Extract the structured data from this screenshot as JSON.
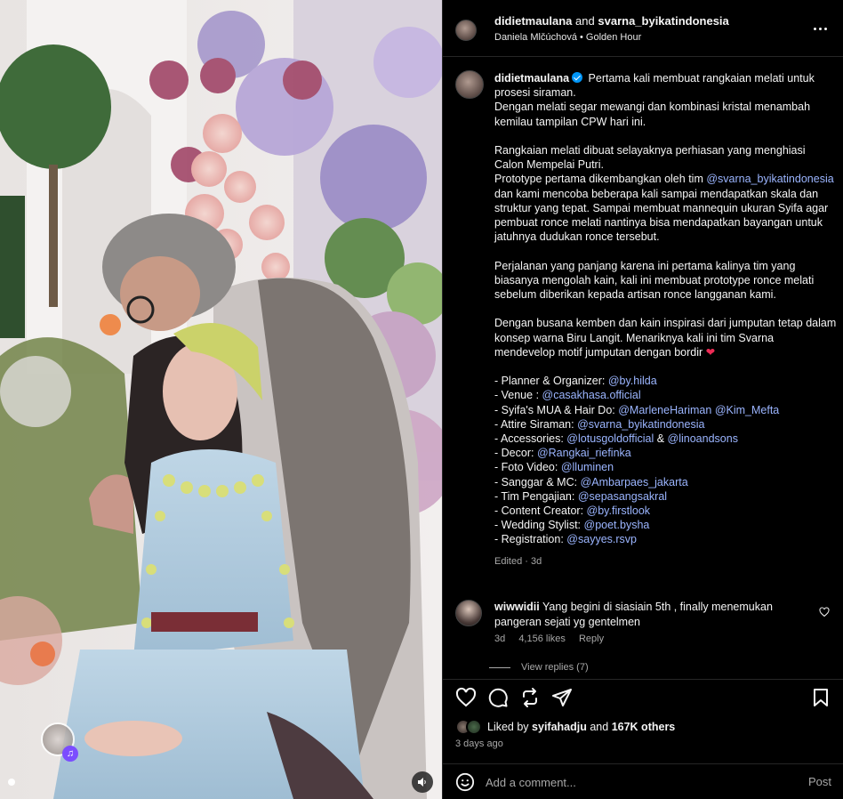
{
  "header": {
    "user1": "didietmaulana",
    "conj": "and",
    "user2": "svarna_byikatindonesia",
    "audio": "Daniela Mlčúchová • Golden Hour"
  },
  "caption": {
    "username": "didietmaulana",
    "intro": "Pertama kali membuat rangkaian melati untuk prosesi siraman.",
    "p1": "Dengan melati segar mewangi dan kombinasi kristal menambah kemilau tampilan CPW hari ini.",
    "p2a": "Rangkaian melati dibuat selayaknya perhiasan yang menghiasi Calon Mempelai Putri.",
    "p2b": "Prototype pertama dikembangkan oleh tim",
    "p2_mention": "@svarna_byikatindonesia",
    "p2c": "dan kami mencoba beberapa kali sampai mendapatkan skala dan struktur yang tepat. Sampai membuat mannequin ukuran Syifa agar pembuat ronce melati nantinya bisa mendapatkan bayangan untuk jatuhnya dudukan ronce tersebut.",
    "p3": "Perjalanan yang panjang karena ini pertama kalinya tim yang biasanya mengolah kain, kali ini membuat prototype ronce melati sebelum diberikan kepada artisan ronce langganan kami.",
    "p4": "Dengan busana kemben dan kain inspirasi dari jumputan tetap dalam konsep warna Biru Langit. Menariknya kali ini tim Svarna mendevelop motif jumputan dengan bordir",
    "heart": "❤",
    "credits": [
      {
        "label": "- Planner & Organizer:",
        "mentions": [
          "@by.hilda"
        ],
        "sep": ""
      },
      {
        "label": "- Venue :",
        "mentions": [
          "@casakhasa.official"
        ],
        "sep": ""
      },
      {
        "label": "- Syifa's MUA & Hair Do:",
        "mentions": [
          "@MarleneHariman",
          "@Kim_Mefta"
        ],
        "sep": " "
      },
      {
        "label": "- Attire Siraman:",
        "mentions": [
          "@svarna_byikatindonesia"
        ],
        "sep": ""
      },
      {
        "label": "- Accessories:",
        "mentions": [
          "@lotusgoldofficial",
          "@linoandsons"
        ],
        "sep": " & "
      },
      {
        "label": "- Decor:",
        "mentions": [
          "@Rangkai_riefinka"
        ],
        "sep": ""
      },
      {
        "label": "- Foto Video:",
        "mentions": [
          "@lluminen"
        ],
        "sep": ""
      },
      {
        "label": "- Sanggar & MC:",
        "mentions": [
          "@Ambarpaes_jakarta"
        ],
        "sep": ""
      },
      {
        "label": "- Tim Pengajian:",
        "mentions": [
          "@sepasangsakral"
        ],
        "sep": ""
      },
      {
        "label": "- Content Creator:",
        "mentions": [
          "@by.firstlook"
        ],
        "sep": ""
      },
      {
        "label": "- Wedding Stylist:",
        "mentions": [
          "@poet.bysha"
        ],
        "sep": ""
      },
      {
        "label": "- Registration:",
        "mentions": [
          "@sayyes.rsvp"
        ],
        "sep": ""
      }
    ],
    "edited": "Edited · 3d"
  },
  "comment": {
    "username": "wiwwidii",
    "text": "Yang begini di siasiain 5th , finally menemukan pangeran sejati yg gentelmen",
    "age": "3d",
    "likes": "4,156 likes",
    "reply": "Reply",
    "view_replies": "View replies (7)"
  },
  "likes": {
    "prefix": "Liked by",
    "user": "syifahadju",
    "mid": "and",
    "count": "167K others"
  },
  "date": "3 days ago",
  "add_comment": {
    "placeholder": "Add a comment...",
    "post": "Post"
  },
  "colors": {
    "link": "#9bb5ff",
    "verified": "#0095f6",
    "heart": "#ed2b55"
  }
}
